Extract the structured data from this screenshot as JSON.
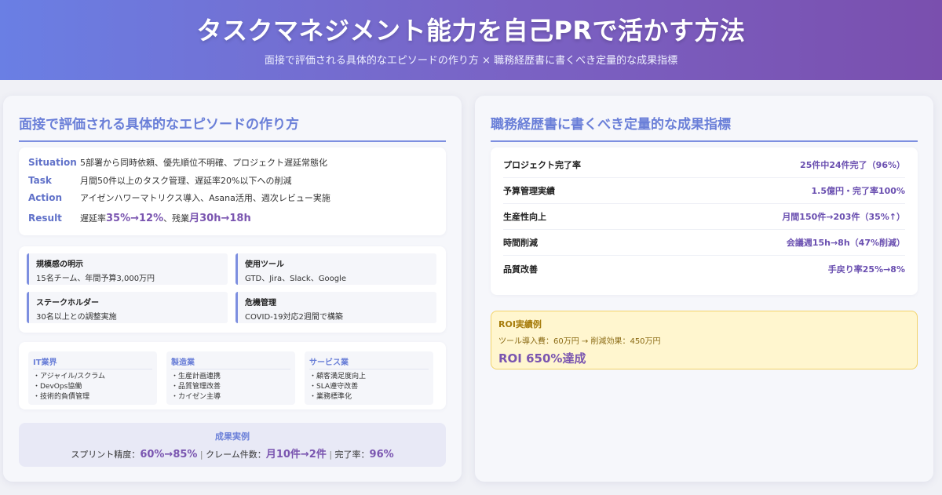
{
  "header": {
    "title": "タスクマネジメント能力を自己PRで活かす方法",
    "subtitle": "面接で評価される具体的なエピソードの作り方 × 職務経歴書に書くべき定量的な成果指標"
  },
  "left": {
    "title": "面接で評価される具体的なエピソードの作り方",
    "star": {
      "situation_key": "Situation",
      "situation_val": "5部署から同時依頼、優先順位不明確、プロジェクト遅延常態化",
      "task_key": "Task",
      "task_val": "月間50件以上のタスク管理、遅延率20%以下への削減",
      "action_key": "Action",
      "action_val": "アイゼンハワーマトリクス導入、Asana活用、週次レビュー実施",
      "result_key": "Result",
      "result_pre1": "遅延率",
      "result_hl1": "35%→12%",
      "result_mid": "、残業",
      "result_hl2": "月30h→18h"
    },
    "points": [
      {
        "title": "規模感の明示",
        "body": "15名チーム、年間予算3,000万円"
      },
      {
        "title": "使用ツール",
        "body": "GTD、Jira、Slack、Google"
      },
      {
        "title": "ステークホルダー",
        "body": "30名以上との調整実施"
      },
      {
        "title": "危機管理",
        "body": "COVID-19対応2週間で構築"
      }
    ],
    "industries": [
      {
        "title": "IT業界",
        "items": [
          "・アジャイル/スクラム",
          "・DevOps協働",
          "・技術的負債管理"
        ]
      },
      {
        "title": "製造業",
        "items": [
          "・生産計画連携",
          "・品質管理改善",
          "・カイゼン主導"
        ]
      },
      {
        "title": "サービス業",
        "items": [
          "・顧客満足度向上",
          "・SLA遵守改善",
          "・業務標準化"
        ]
      }
    ],
    "results": {
      "title": "成果実例",
      "label1": "スプリント精度：",
      "val1": "60%→85%",
      "sep1": " | ",
      "label2": "クレーム件数：",
      "val2": "月10件→2件",
      "sep2": " | ",
      "label3": "完了率：",
      "val3": "96%"
    }
  },
  "right": {
    "title": "職務経歴書に書くべき定量的な成果指標",
    "metrics": [
      {
        "label": "プロジェクト完了率",
        "value": "25件中24件完了（96%）"
      },
      {
        "label": "予算管理実績",
        "value": "1.5億円・完了率100%"
      },
      {
        "label": "生産性向上",
        "value": "月間150件→203件（35%↑）"
      },
      {
        "label": "時間削減",
        "value": "会議週15h→8h（47%削減）"
      },
      {
        "label": "品質改善",
        "value": "手戻り率25%→8%"
      }
    ],
    "roi": {
      "title": "ROI実績例",
      "detail": "ツール導入費：60万円 → 削減効果：450万円",
      "result": "ROI 650%達成"
    }
  }
}
